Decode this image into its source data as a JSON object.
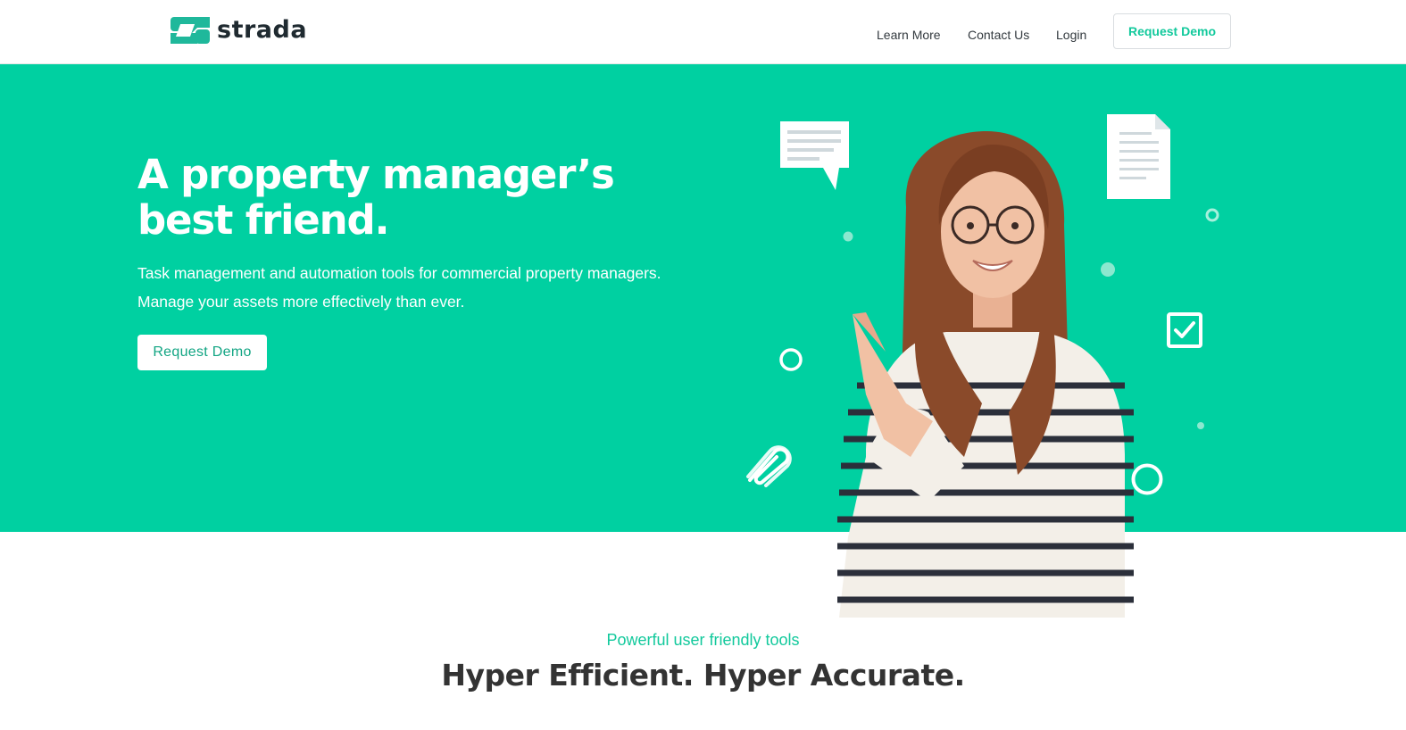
{
  "brand": {
    "name": "strada",
    "accent": "#00D0A1",
    "dark": "#1F2A30"
  },
  "nav": {
    "items": [
      "Learn More",
      "Contact Us",
      "Login"
    ],
    "cta_label": "Request Demo"
  },
  "hero": {
    "title": "A property manager’s best friend.",
    "subtitle_lines": [
      "Task management and automation tools for commercial property managers.",
      "Manage your assets more effectively than ever."
    ],
    "cta_label": "Request Demo",
    "illustration_icons": [
      "chat-bubble-icon",
      "document-icon",
      "checkbox-icon",
      "paperclip-icon",
      "circle-icon"
    ]
  },
  "features": {
    "eyebrow": "Powerful user friendly tools",
    "headline": "Hyper Efficient. Hyper Accurate."
  }
}
